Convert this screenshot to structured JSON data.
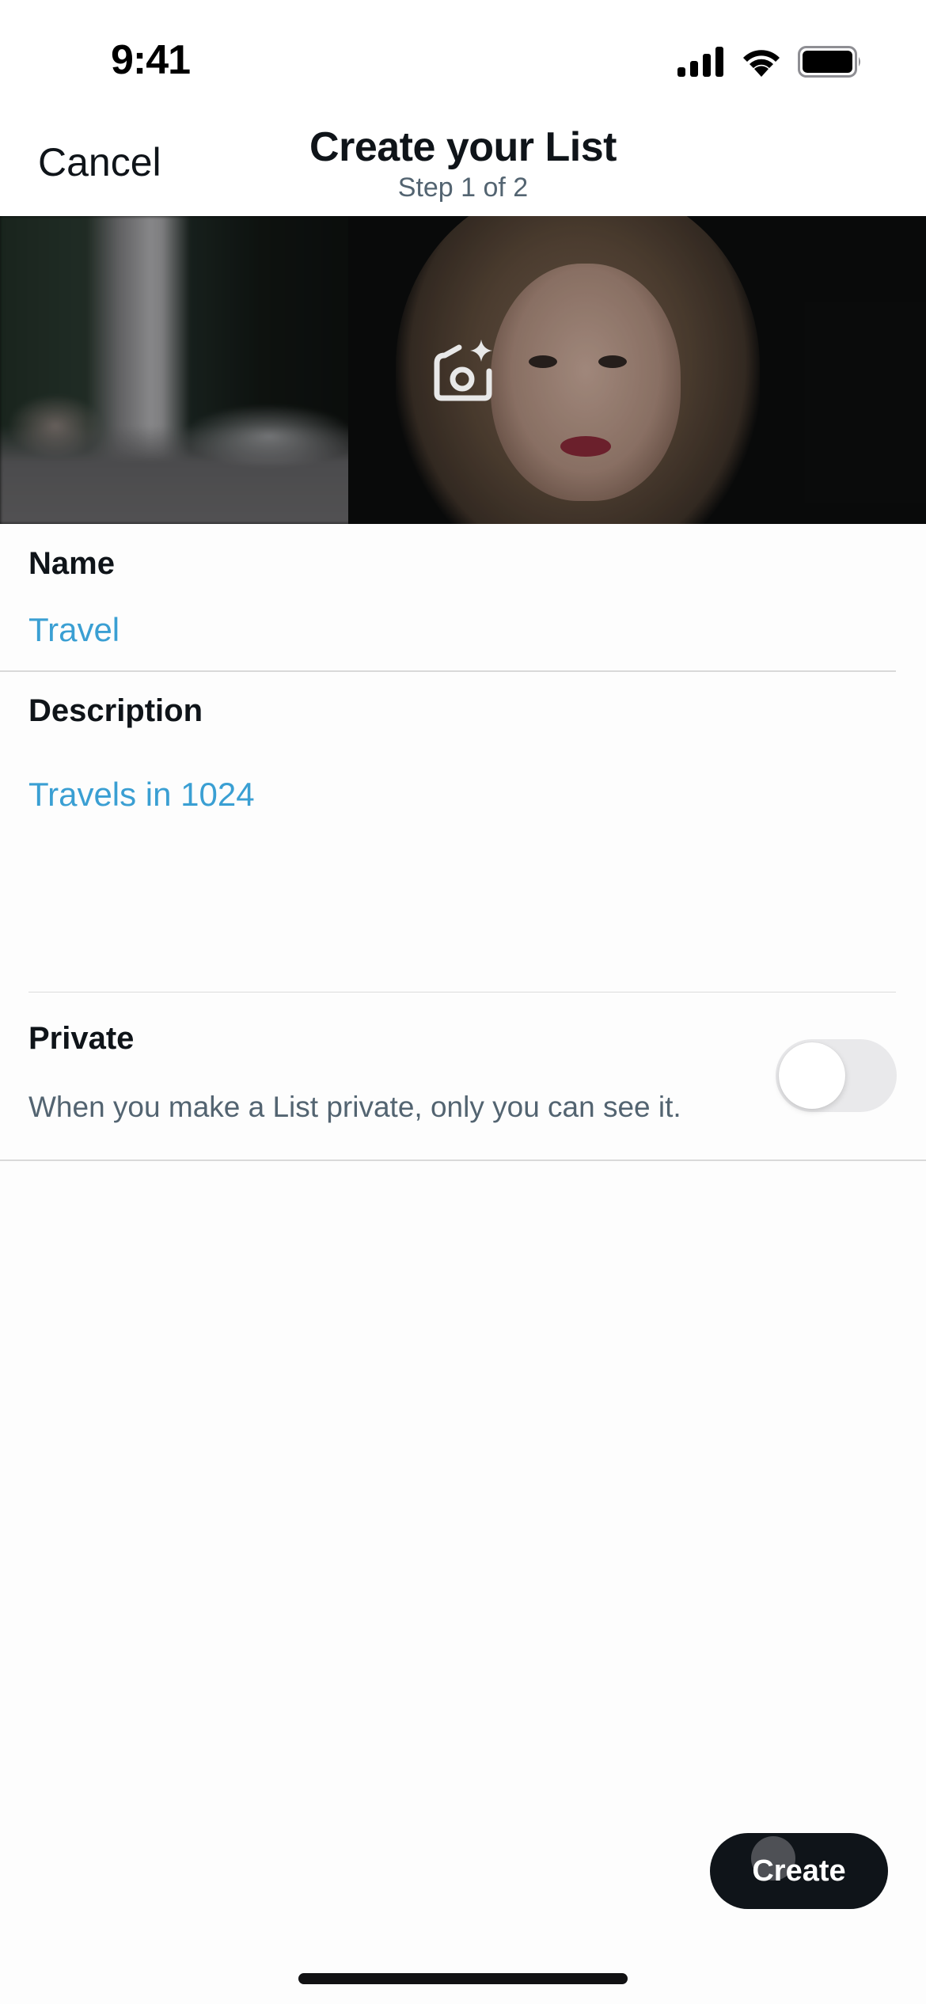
{
  "status_bar": {
    "time": "9:41",
    "icons": [
      "cellular-signal-icon",
      "wifi-icon",
      "battery-icon"
    ]
  },
  "header": {
    "cancel_label": "Cancel",
    "title": "Create your List",
    "subtitle": "Step 1 of 2"
  },
  "banner": {
    "edit_icon": "camera-sparkle-icon"
  },
  "form": {
    "name": {
      "label": "Name",
      "value": "Travel"
    },
    "description": {
      "label": "Description",
      "value": "Travels in 1024"
    },
    "private": {
      "label": "Private",
      "description": "When you make a List private, only you can see it.",
      "enabled": false
    }
  },
  "footer": {
    "create_label": "Create"
  },
  "colors": {
    "accent_value": "#3a9fd3",
    "primary_text": "#0f1419",
    "secondary_text": "#536471",
    "button_bg": "#0f1419"
  }
}
